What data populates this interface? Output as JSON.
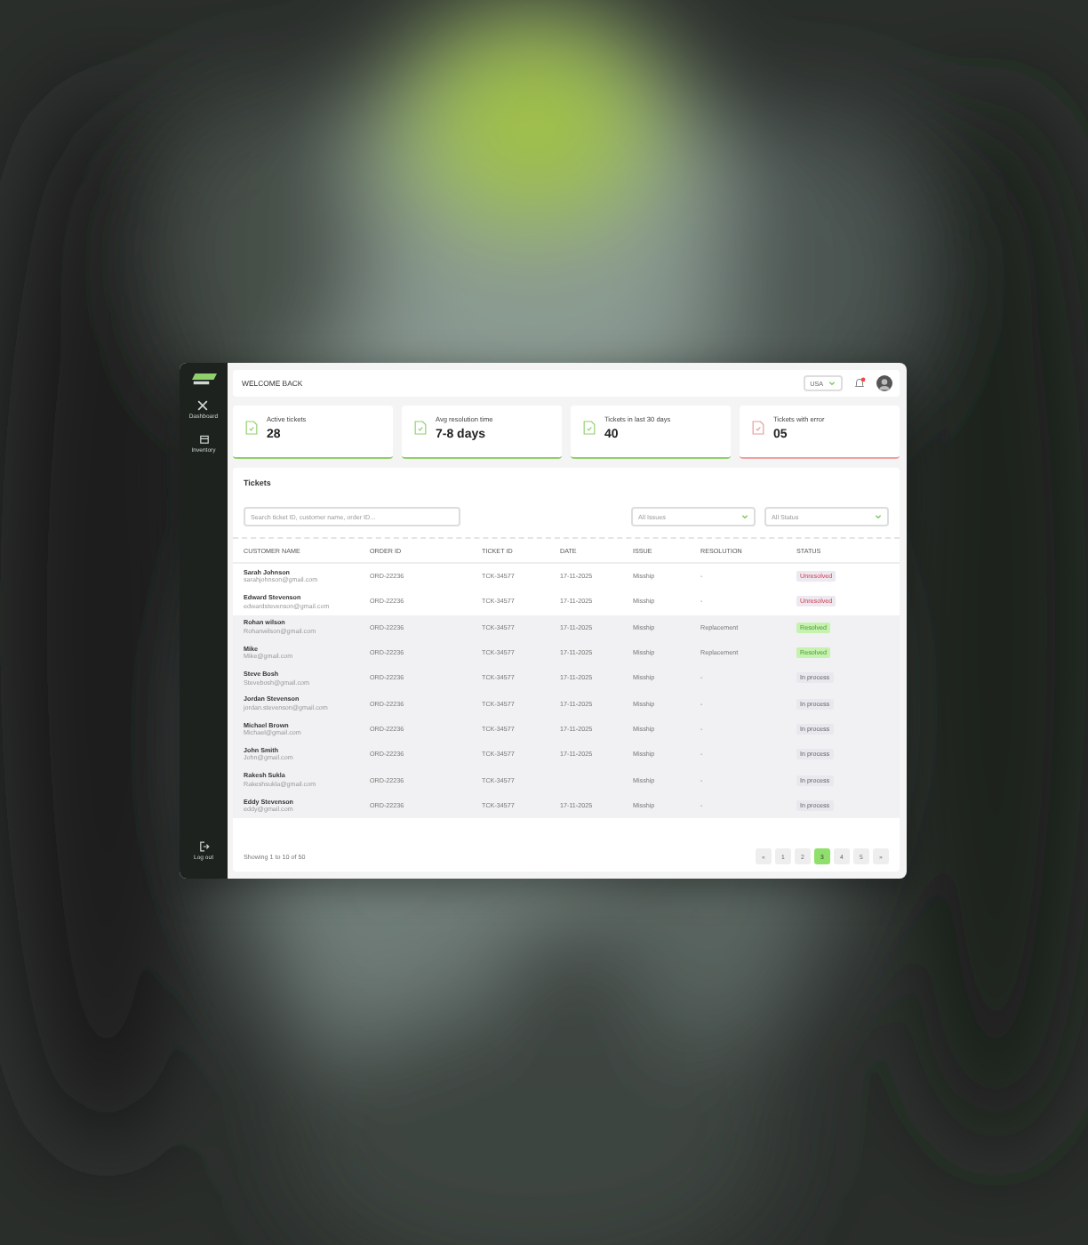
{
  "sidebar": {
    "items": [
      {
        "label": "Dashboard"
      },
      {
        "label": "Inventory"
      }
    ],
    "logout": "Log out"
  },
  "header": {
    "greeting": "WELCOME BACK",
    "country": "USA",
    "notifications": true
  },
  "cards": [
    {
      "label": "Active tickets",
      "value": "28",
      "alert": false
    },
    {
      "label": "Avg resolution time",
      "value": "7-8 days",
      "alert": false
    },
    {
      "label": "Tickets in last 30 days",
      "value": "40",
      "alert": false
    },
    {
      "label": "Tickets with error",
      "value": "05",
      "alert": true
    }
  ],
  "tickets": {
    "title": "Tickets",
    "search": {
      "placeholder": "Search ticket ID, customer name, order ID..."
    },
    "filters": [
      {
        "placeholder": "All Issues"
      },
      {
        "placeholder": "All Status"
      }
    ],
    "columns": [
      "CUSTOMER NAME",
      "ORDER ID",
      "TICKET ID",
      "DATE",
      "ISSUE",
      "RESOLUTION",
      "STATUS"
    ],
    "rows": [
      {
        "name": "Sarah Johnson",
        "email": "sarahjohnson@gmail.com",
        "order": "ORD-22236",
        "ticket": "TCK-34577",
        "date": "17-11-2025",
        "issue": "Misship",
        "resolution": "-",
        "status": "Unresolved",
        "kind": "unresolved",
        "shaded": false
      },
      {
        "name": "Edward Stevenson",
        "email": "edwardstevenson@gmail.com",
        "order": "ORD-22236",
        "ticket": "TCK-34577",
        "date": "17-11-2025",
        "issue": "Misship",
        "resolution": "-",
        "status": "Unresolved",
        "kind": "unresolved",
        "shaded": false
      },
      {
        "name": "Rohan wilson",
        "email": "Rohanwilson@gmail.com",
        "order": "ORD-22236",
        "ticket": "TCK-34577",
        "date": "17-11-2025",
        "issue": "Misship",
        "resolution": "Replacement",
        "status": "Resolved",
        "kind": "resolved",
        "shaded": true
      },
      {
        "name": "Mike",
        "email": "Mike@gmail.com",
        "order": "ORD-22236",
        "ticket": "TCK-34577",
        "date": "17-11-2025",
        "issue": "Misship",
        "resolution": "Replacement",
        "status": "Resolved",
        "kind": "resolved",
        "shaded": true
      },
      {
        "name": "Steve Bosh",
        "email": "Stevebosh@gmail.com",
        "order": "ORD-22236",
        "ticket": "TCK-34577",
        "date": "17-11-2025",
        "issue": "Misship",
        "resolution": "-",
        "status": "In process",
        "kind": "process",
        "shaded": true
      },
      {
        "name": "Jordan Stevenson",
        "email": "jordan.stevenson@gmail.com",
        "order": "ORD-22236",
        "ticket": "TCK-34577",
        "date": "17-11-2025",
        "issue": "Misship",
        "resolution": "-",
        "status": "In process",
        "kind": "process",
        "shaded": true
      },
      {
        "name": "Michael Brown",
        "email": "Michael@gmail.com",
        "order": "ORD-22236",
        "ticket": "TCK-34577",
        "date": "17-11-2025",
        "issue": "Misship",
        "resolution": "-",
        "status": "In process",
        "kind": "process",
        "shaded": true
      },
      {
        "name": "John Smith",
        "email": "John@gmail.com",
        "order": "ORD-22236",
        "ticket": "TCK-34577",
        "date": "17-11-2025",
        "issue": "Misship",
        "resolution": "-",
        "status": "In process",
        "kind": "process",
        "shaded": true
      },
      {
        "name": "Rakesh Sukla",
        "email": "Rakeshsukla@gmail.com",
        "order": "ORD-22236",
        "ticket": "TCK-34577",
        "issue": "Misship",
        "resolution": "-",
        "status": "In process",
        "kind": "process",
        "shaded": true
      },
      {
        "name": "Eddy Stevenson",
        "email": "eddy@gmail.com",
        "order": "ORD-22236",
        "ticket": "TCK-34577",
        "date": "17-11-2025",
        "issue": "Misship",
        "resolution": "-",
        "status": "In process",
        "kind": "process",
        "shaded": true
      }
    ],
    "summary": "Showing 1 to 10 of 50",
    "pages": [
      {
        "label": "«",
        "selected": false
      },
      {
        "label": "1",
        "selected": false
      },
      {
        "label": "2",
        "selected": false
      },
      {
        "label": "3",
        "selected": true
      },
      {
        "label": "4",
        "selected": false
      },
      {
        "label": "5",
        "selected": false
      },
      {
        "label": "»",
        "selected": false
      }
    ]
  }
}
